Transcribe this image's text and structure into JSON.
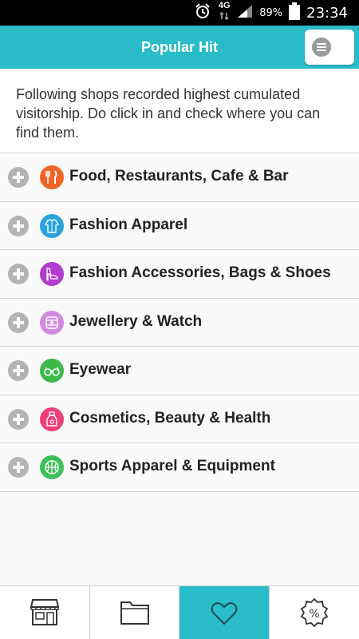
{
  "status_bar": {
    "network": "4G",
    "battery": "89%",
    "time": "23:34",
    "icons": [
      "alarm-icon",
      "data-arrows-icon",
      "signal-icon",
      "battery-icon"
    ]
  },
  "header": {
    "title": "Popular Hit",
    "menu_icon": "menu-icon"
  },
  "intro": {
    "text": "Following shops recorded highest cumulated visitorship. Do click in and check where you can find them."
  },
  "categories": [
    {
      "label": "Food, Restaurants, Cafe & Bar",
      "icon": "fork-knife-icon",
      "color": "#ef6528"
    },
    {
      "label": "Fashion Apparel",
      "icon": "shirt-icon",
      "color": "#2aa2dc"
    },
    {
      "label": "Fashion Accessories, Bags & Shoes",
      "icon": "high-heel-icon",
      "color": "#b13ccf"
    },
    {
      "label": "Jewellery & Watch",
      "icon": "jewellery-icon",
      "color": "#d28be0"
    },
    {
      "label": "Eyewear",
      "icon": "glasses-icon",
      "color": "#3db84a"
    },
    {
      "label": "Cosmetics, Beauty & Health",
      "icon": "perfume-icon",
      "color": "#ee3f7a"
    },
    {
      "label": "Sports Apparel & Equipment",
      "icon": "basketball-icon",
      "color": "#3dbf5a"
    }
  ],
  "bottom_nav": [
    {
      "icon": "store-icon",
      "active": false
    },
    {
      "icon": "folder-icon",
      "active": false
    },
    {
      "icon": "heart-icon",
      "active": true
    },
    {
      "icon": "discount-badge-icon",
      "active": false
    }
  ],
  "colors": {
    "accent": "#2bbcc9",
    "plus_gray": "#b3b3b3"
  }
}
